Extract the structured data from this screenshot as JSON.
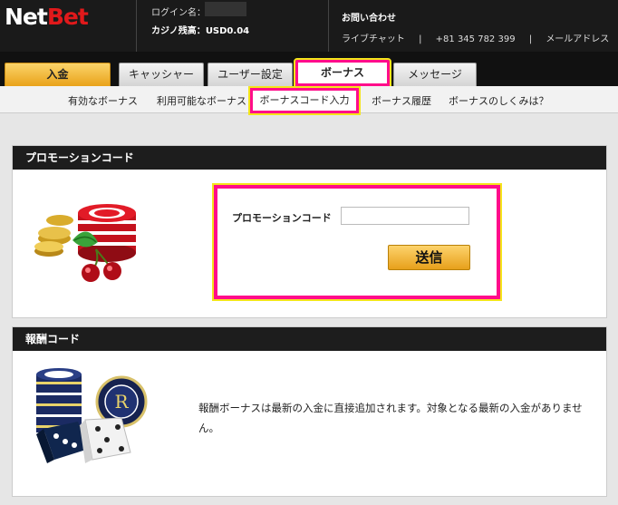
{
  "header": {
    "logo_net": "Net",
    "logo_bet": "Bet",
    "login_label": "ログイン名：",
    "balance_label": "カジノ残高：",
    "balance_value": "USD0.04",
    "contact_title": "お問い合わせ",
    "live_chat": "ライブチャット",
    "separator": "|",
    "phone": "+81 345 782 399",
    "email": "メールアドレス"
  },
  "tabs": {
    "deposit": "入金",
    "cashier": "キャッシャー",
    "user_settings": "ユーザー設定",
    "bonus": "ボーナス",
    "message": "メッセージ"
  },
  "subnav": {
    "active_bonuses": "有効なボーナス",
    "available_bonuses": "利用可能なボーナス",
    "bonus_code_entry": "ボーナスコード入力",
    "bonus_history": "ボーナス履歴",
    "how_bonus_works": "ボーナスのしくみは？"
  },
  "promo_panel": {
    "title": "プロモーションコード",
    "field_label": "プロモーションコード",
    "field_value": "",
    "submit_label": "送信"
  },
  "reward_panel": {
    "title": "報酬コード",
    "description": "報酬ボーナスは最新の入金に直接追加されます。対象となる最新の入金がありません。"
  },
  "colors": {
    "highlight_pink": "#ff0d8a",
    "highlight_yellow": "#f4e51a",
    "accent_orange": "#e9a21a",
    "brand_red": "#e0191b",
    "header_bg": "#1a1a1a"
  },
  "icons": [
    "chips-cherries-illustration",
    "chips-dice-illustration"
  ]
}
